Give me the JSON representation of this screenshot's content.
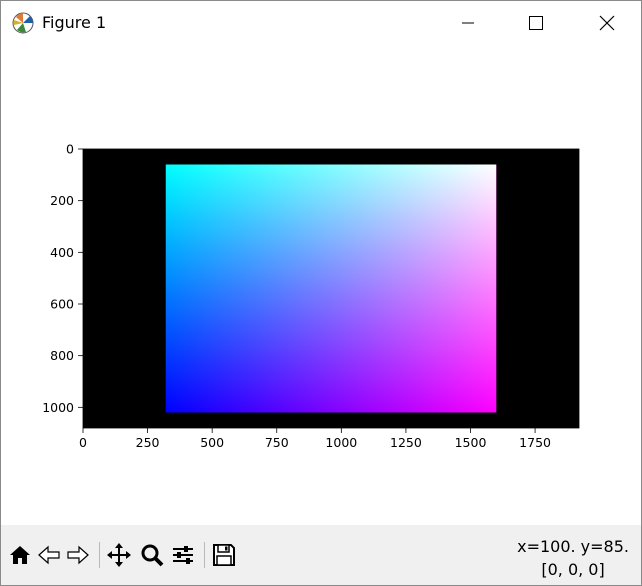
{
  "window": {
    "title": "Figure 1"
  },
  "chart_data": {
    "type": "heatmap",
    "description": "imshow RGB image: black background with a gradient rectangle",
    "xlim": [
      0,
      1920
    ],
    "ylim": [
      1080,
      0
    ],
    "x_ticks": [
      "0",
      "250",
      "500",
      "750",
      "1000",
      "1250",
      "1500",
      "1750"
    ],
    "x_tick_values": [
      0,
      250,
      500,
      750,
      1000,
      1250,
      1500,
      1750
    ],
    "y_ticks": [
      "0",
      "200",
      "400",
      "600",
      "800",
      "1000"
    ],
    "y_tick_values": [
      0,
      200,
      400,
      600,
      800,
      1000
    ],
    "gradient_rect": {
      "x0": 320,
      "x1": 1600,
      "y0": 60,
      "y1": 1020
    },
    "corner_colors": {
      "top_left": "#00ffff",
      "top_right": "#ffffff",
      "bottom_left": "#0000ff",
      "bottom_right": "#ff00ff"
    },
    "background": "#000000"
  },
  "toolbar": {
    "icons": [
      "home-icon",
      "back-arrow-icon",
      "forward-arrow-icon",
      "pan-icon",
      "zoom-icon",
      "configure-subplots-icon",
      "save-icon"
    ],
    "coord_text": "x=100. y=85.",
    "pixel_value": "[0, 0, 0]"
  }
}
